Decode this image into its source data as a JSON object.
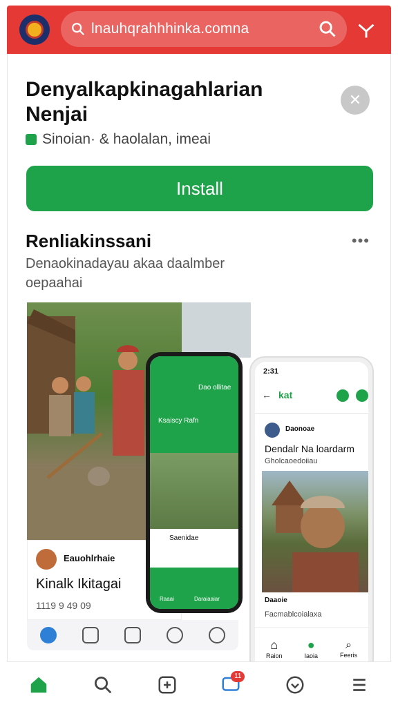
{
  "header": {
    "search_text": "lnauhqrahhhinka.comna"
  },
  "app": {
    "title": "Denyalkapkinagahlarian Nenjai",
    "subtitle": "Sinoian· & haolalan, imeai",
    "install_label": "Install"
  },
  "section": {
    "title": "Renliakinssani",
    "description": "Denaokinadayau akaa daalmber oepaahai"
  },
  "gallery": {
    "post_author": "Eauohlrhaie",
    "post_title": "Kinalk Ikitagai",
    "post_meta": "1119 9 49 09",
    "phone_mid": {
      "text1": "Dao ollitae",
      "text2": "Ksaiscy Rafn",
      "row_text": "Saenidae",
      "nav_item1": "Raaai",
      "nav_item2": "Daraiaaiar"
    },
    "phone_right": {
      "status": "2:31",
      "header_label": "kat",
      "author": "Daonoae",
      "post_title": "Dendalr Na loardarm",
      "post_sub": "Gholcaoedoiiau",
      "footer_author": "Daaoie",
      "footer_text": "Facmablcoialaxa",
      "nav": [
        "Raion",
        "Iaoia",
        "Feeris"
      ]
    }
  },
  "bottom_nav": {
    "badge": "11"
  },
  "colors": {
    "brand_red": "#e53935",
    "install_green": "#1fa34a"
  }
}
